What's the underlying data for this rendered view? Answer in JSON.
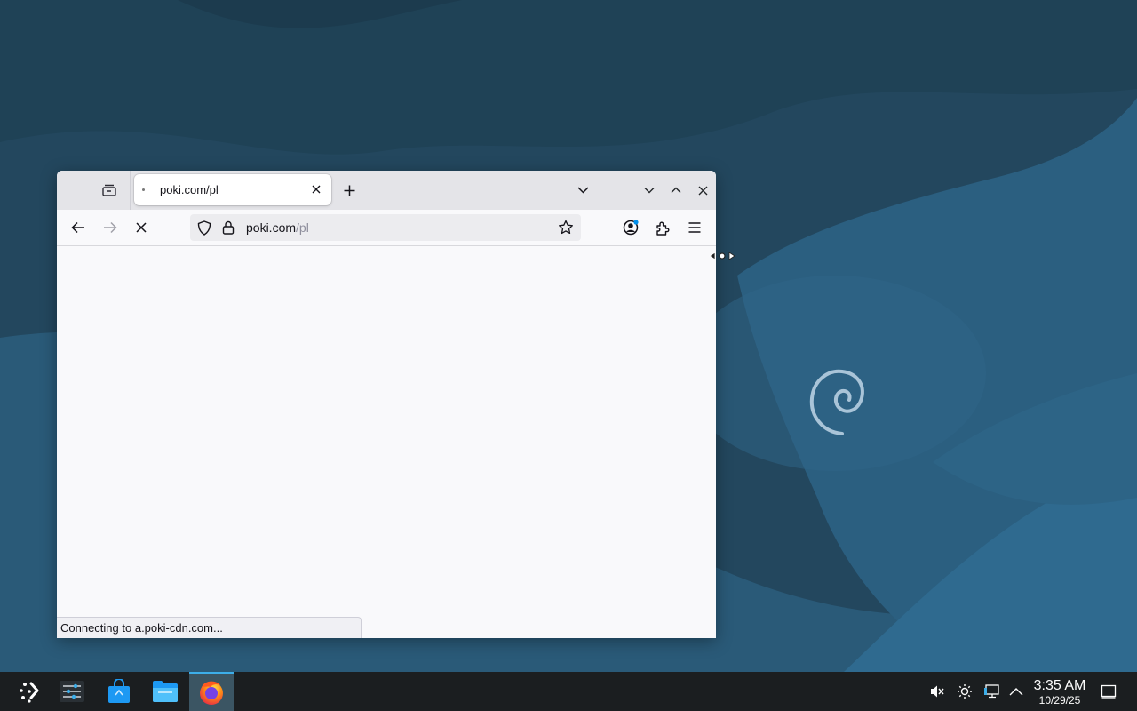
{
  "desktop": {
    "wallpaper": "debian-swirl-blue",
    "colors": {
      "dark": "#1f4459",
      "mid": "#2b5873",
      "light": "#336a8c"
    }
  },
  "browser": {
    "tab": {
      "title": "poki.com/pl"
    },
    "urlbar": {
      "host": "poki.com",
      "path": "/pl"
    },
    "status_text": "Connecting to a.poki-cdn.com...",
    "loading": true
  },
  "taskbar": {
    "apps": [
      {
        "name": "application-launcher",
        "icon": "debian-launcher-icon"
      },
      {
        "name": "system-settings",
        "icon": "settings-sliders-icon"
      },
      {
        "name": "discover",
        "icon": "store-bag-icon"
      },
      {
        "name": "dolphin",
        "icon": "folder-icon"
      },
      {
        "name": "firefox",
        "icon": "firefox-icon",
        "active": true
      }
    ],
    "tray": [
      "volume-muted-icon",
      "brightness-icon",
      "network-icon",
      "tray-expand-icon"
    ],
    "clock": {
      "time": "3:35 AM",
      "date": "10/29/25"
    }
  }
}
